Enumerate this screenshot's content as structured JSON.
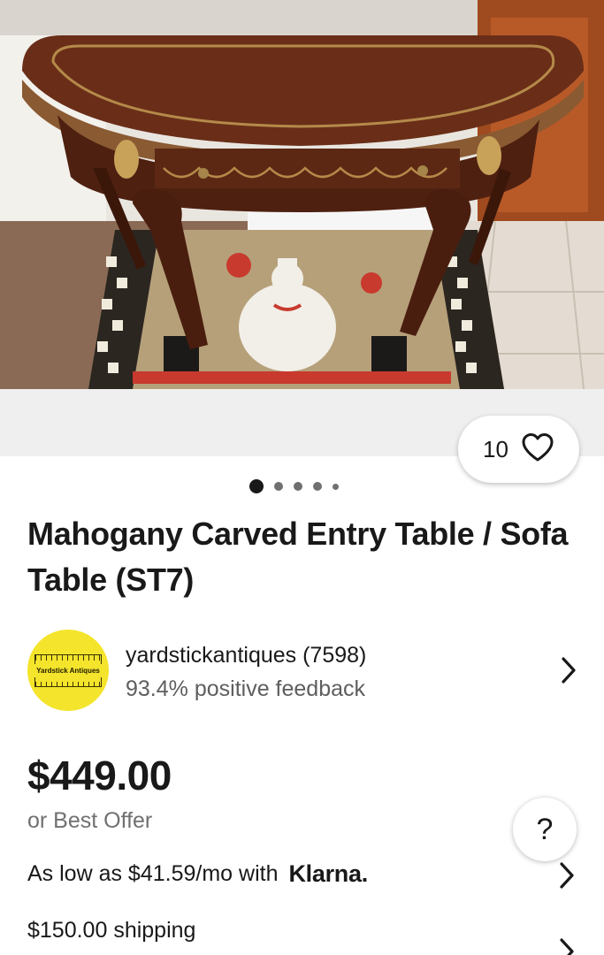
{
  "listing": {
    "photo_alt": "hero-photo",
    "watch_count": "10",
    "carousel": {
      "total": 5,
      "active_index": 0
    },
    "title": "Mahogany Carved Entry Table / Sofa Table (ST7)"
  },
  "seller": {
    "name_with_score": "yardstickantiques (7598)",
    "feedback": "93.4% positive feedback",
    "logo_text": "Yardstick Antiques",
    "logo_color": "#f4e42c"
  },
  "pricing": {
    "price": "$449.00",
    "best_offer": "or Best Offer",
    "installment_text": "As low as $41.59/mo with",
    "installment_provider": "Klarna.",
    "shipping": "$150.00 shipping"
  },
  "help": {
    "label": "?"
  },
  "colors": {
    "text_primary": "#191919",
    "text_secondary": "#707070",
    "band_background": "#efefef"
  }
}
